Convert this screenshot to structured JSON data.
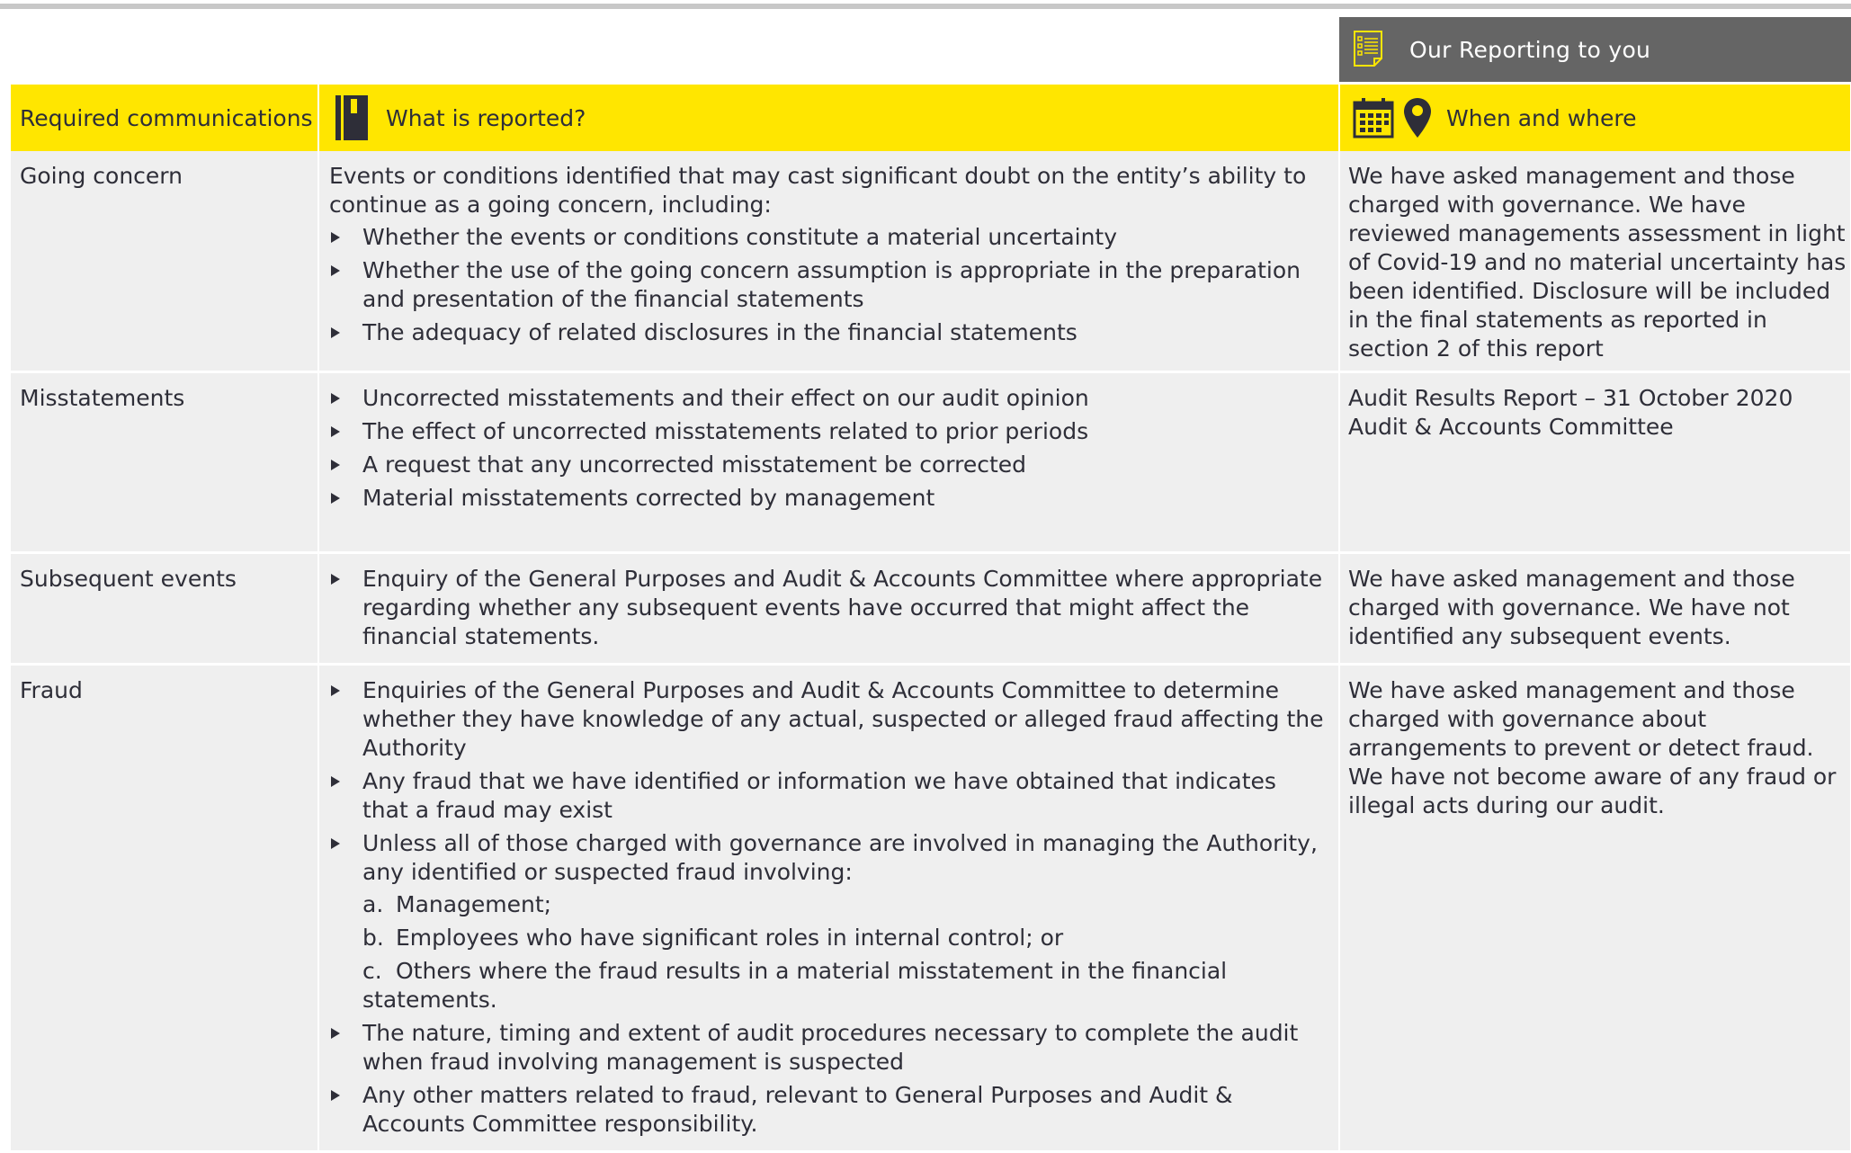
{
  "header": {
    "reporting_tab": "Our Reporting to you",
    "col1": "Required communications",
    "col2": "What is reported?",
    "col3": "When and where"
  },
  "rows": [
    {
      "name": "Going concern",
      "intro": "Events or conditions identified that may cast significant doubt on the entity’s ability to continue as a going concern, including:",
      "bullets": [
        "Whether the events or conditions constitute a material uncertainty",
        "Whether the use of the going concern assumption is appropriate in the preparation and presentation of the financial statements",
        "The adequacy of related disclosures in the financial statements"
      ],
      "when": "We have asked management and those charged with governance.  We have reviewed managements assessment in light of Covid-19 and no material uncertainty has been identified. Disclosure will be included in the final statements as reported in section 2 of this report"
    },
    {
      "name": "Misstatements",
      "bullets": [
        "Uncorrected misstatements and their effect on our audit opinion",
        "The effect of uncorrected misstatements related to prior periods",
        "A request that any uncorrected misstatement be corrected",
        "Material misstatements corrected by management"
      ],
      "when": "Audit Results Report – 31 October 2020 Audit & Accounts Committee"
    },
    {
      "name": "Subsequent events",
      "bullets": [
        "Enquiry of the General Purposes and Audit & Accounts Committee where appropriate regarding whether any subsequent events have occurred that might affect the financial statements."
      ],
      "when": "We have asked management and those charged with governance. We have not identified any subsequent events."
    },
    {
      "name": "Fraud",
      "bullets": [
        "Enquiries of the General Purposes and Audit & Accounts Committee to determine whether they have knowledge of any actual, suspected or alleged fraud affecting the Authority",
        "Any fraud that we have identified or information we have obtained that indicates that a fraud may exist",
        "Unless all of those charged with governance are involved in managing the Authority, any identified or suspected fraud involving:",
        "The nature, timing and extent of audit procedures necessary to complete the audit when fraud involving management is suspected",
        "Any other matters related to fraud, relevant to General Purposes and Audit & Accounts Committee responsibility."
      ],
      "sub": [
        {
          "marker": "a.",
          "text": "Management;"
        },
        {
          "marker": "b.",
          "text": "Employees who have significant roles in internal control; or"
        },
        {
          "marker": "c.",
          "text": "Others where the fraud results in a material misstatement in the financial statements."
        }
      ],
      "when": "We have asked management and those charged with governance about arrangements to prevent or detect fraud. We have not become aware of any fraud or illegal acts during our audit."
    }
  ],
  "icons": {
    "report": "report-checklist-icon",
    "notebook": "notebook-icon",
    "calendar": "calendar-icon",
    "location": "location-pin-icon"
  },
  "colors": {
    "header_yellow": "#ffe600",
    "tab_grey": "#656565",
    "cell_grey": "#efefef",
    "text": "#2e2e38"
  }
}
